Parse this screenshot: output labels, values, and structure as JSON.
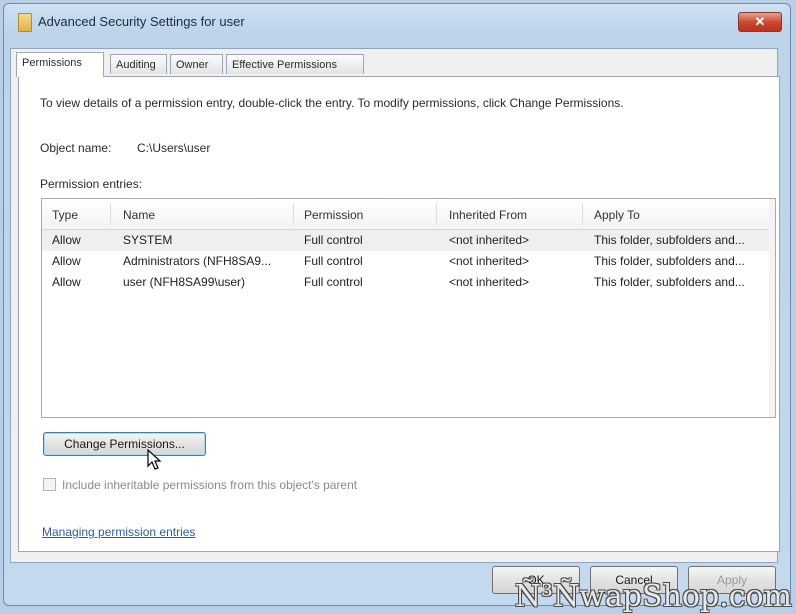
{
  "window": {
    "title": "Advanced Security Settings for user",
    "close_glyph": "✕"
  },
  "tabs": [
    {
      "label": "Permissions",
      "active": true
    },
    {
      "label": "Auditing",
      "active": false
    },
    {
      "label": "Owner",
      "active": false
    },
    {
      "label": "Effective Permissions",
      "active": false
    }
  ],
  "panel": {
    "instructions": "To view details of a permission entry, double-click the entry. To modify permissions, click Change Permissions.",
    "object_name_label": "Object name:",
    "object_name_value": "C:\\Users\\user",
    "entries_label": "Permission entries:"
  },
  "permission_table": {
    "columns": [
      "Type",
      "Name",
      "Permission",
      "Inherited From",
      "Apply To"
    ],
    "rows": [
      {
        "type": "Allow",
        "name": "SYSTEM",
        "permission": "Full control",
        "inherited_from": "<not inherited>",
        "apply_to": "This folder, subfolders and..."
      },
      {
        "type": "Allow",
        "name": "Administrators (NFH8SA9...",
        "permission": "Full control",
        "inherited_from": "<not inherited>",
        "apply_to": "This folder, subfolders and..."
      },
      {
        "type": "Allow",
        "name": "user (NFH8SA99\\user)",
        "permission": "Full control",
        "inherited_from": "<not inherited>",
        "apply_to": "This folder, subfolders and..."
      }
    ]
  },
  "buttons": {
    "change_permissions": "Change Permissions...",
    "ok": "OK",
    "cancel": "Cancel",
    "apply": "Apply"
  },
  "inherit_checkbox": {
    "label": "Include inheritable permissions from this object's parent",
    "checked": false,
    "enabled": false
  },
  "help_link": "Managing permission entries",
  "watermark": "Ñ³ÑwapShop.com",
  "colors": {
    "window_frame": "#bcd3ea",
    "close_button": "#c9452b",
    "link": "#2c5ea6",
    "focus_border": "#3c7fb1"
  },
  "icons": [
    "folder-icon",
    "close-icon",
    "mouse-cursor-icon",
    "checkbox-icon"
  ]
}
